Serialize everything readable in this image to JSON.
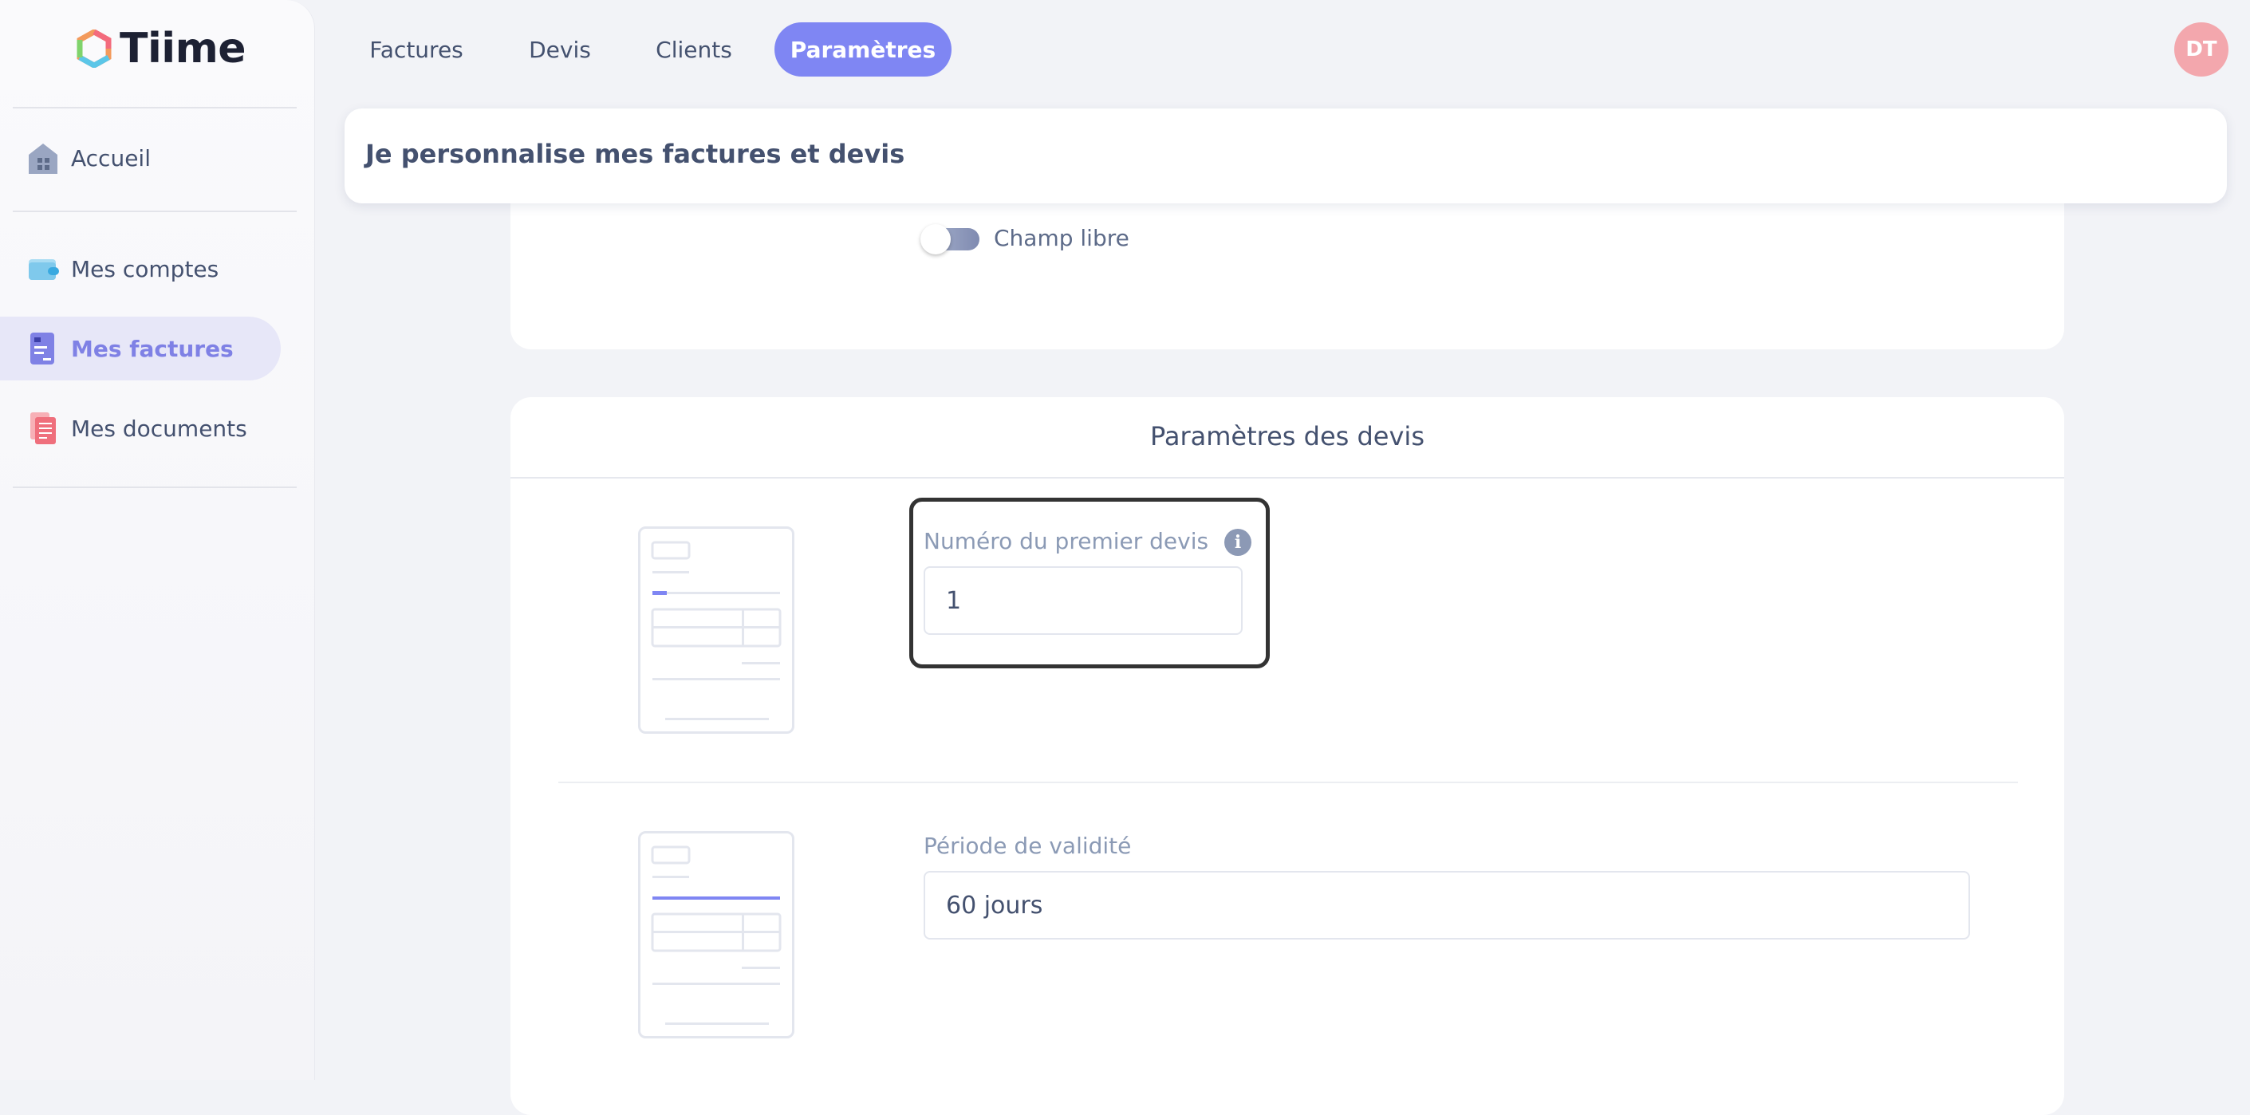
{
  "brand": {
    "name": "Tiime"
  },
  "sidebar": {
    "items": [
      {
        "label": "Accueil",
        "icon": "home-icon"
      },
      {
        "label": "Mes comptes",
        "icon": "wallet-icon"
      },
      {
        "label": "Mes factures",
        "icon": "invoice-icon",
        "active": true
      },
      {
        "label": "Mes documents",
        "icon": "documents-icon"
      }
    ]
  },
  "topnav": {
    "tabs": [
      {
        "label": "Factures"
      },
      {
        "label": "Devis"
      },
      {
        "label": "Clients"
      },
      {
        "label": "Paramètres",
        "active": true
      }
    ],
    "avatar_initials": "DT"
  },
  "header": {
    "title": "Je personnalise mes factures et devis"
  },
  "free_field": {
    "toggle_label": "Champ libre",
    "enabled": false
  },
  "devis_settings": {
    "title": "Paramètres des devis",
    "first_number": {
      "label": "Numéro du premier devis",
      "value": "1"
    },
    "validity": {
      "label": "Période de validité",
      "value": "60 jours"
    }
  },
  "colors": {
    "accent": "#7f86f3",
    "sidebar_active_bg": "#e7e7f8",
    "sidebar_active_text": "#7f81e5",
    "avatar_bg": "#f3a7ad",
    "page_bg": "#f2f3f7"
  }
}
